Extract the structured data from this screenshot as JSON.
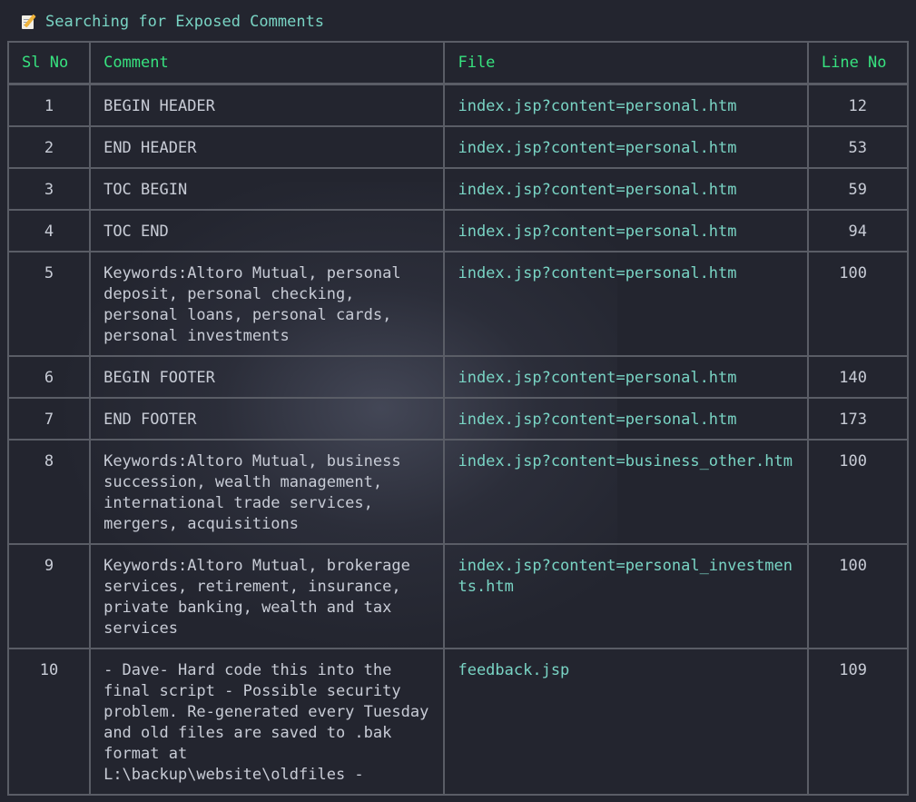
{
  "header": {
    "icon": "memo-icon",
    "title": "Searching for Exposed Comments"
  },
  "table": {
    "columns": [
      "Sl No",
      "Comment",
      "File",
      "Line No"
    ],
    "rows": [
      {
        "sl": "1",
        "comment": "BEGIN HEADER",
        "file": "index.jsp?content=personal.htm",
        "line": "12"
      },
      {
        "sl": "2",
        "comment": "END HEADER",
        "file": "index.jsp?content=personal.htm",
        "line": "53"
      },
      {
        "sl": "3",
        "comment": "TOC BEGIN",
        "file": "index.jsp?content=personal.htm",
        "line": "59"
      },
      {
        "sl": "4",
        "comment": "TOC END",
        "file": "index.jsp?content=personal.htm",
        "line": "94"
      },
      {
        "sl": "5",
        "comment": "Keywords:Altoro Mutual, personal deposit, personal checking, personal loans, personal cards, personal investments",
        "file": "index.jsp?content=personal.htm",
        "line": "100"
      },
      {
        "sl": "6",
        "comment": "BEGIN FOOTER",
        "file": "index.jsp?content=personal.htm",
        "line": "140"
      },
      {
        "sl": "7",
        "comment": "END FOOTER",
        "file": "index.jsp?content=personal.htm",
        "line": "173"
      },
      {
        "sl": "8",
        "comment": "Keywords:Altoro Mutual, business succession, wealth management, international trade services, mergers, acquisitions",
        "file": "index.jsp?content=business_other.htm",
        "line": "100"
      },
      {
        "sl": "9",
        "comment": "Keywords:Altoro Mutual, brokerage services, retirement, insurance, private banking, wealth and tax services",
        "file": "index.jsp?content=personal_investments.htm",
        "line": "100"
      },
      {
        "sl": "10",
        "comment": "- Dave- Hard code this into the final script - Possible security problem. Re-generated every Tuesday and old files are saved to .bak format at L:\\backup\\website\\oldfiles -",
        "file": "feedback.jsp",
        "line": "109"
      }
    ]
  },
  "colors": {
    "background": "#23252f",
    "header_text": "#37e27f",
    "title_text": "#79d4c4",
    "file_text": "#79d4c4",
    "body_text": "#c8ccd6",
    "border": "#5a5d66"
  }
}
